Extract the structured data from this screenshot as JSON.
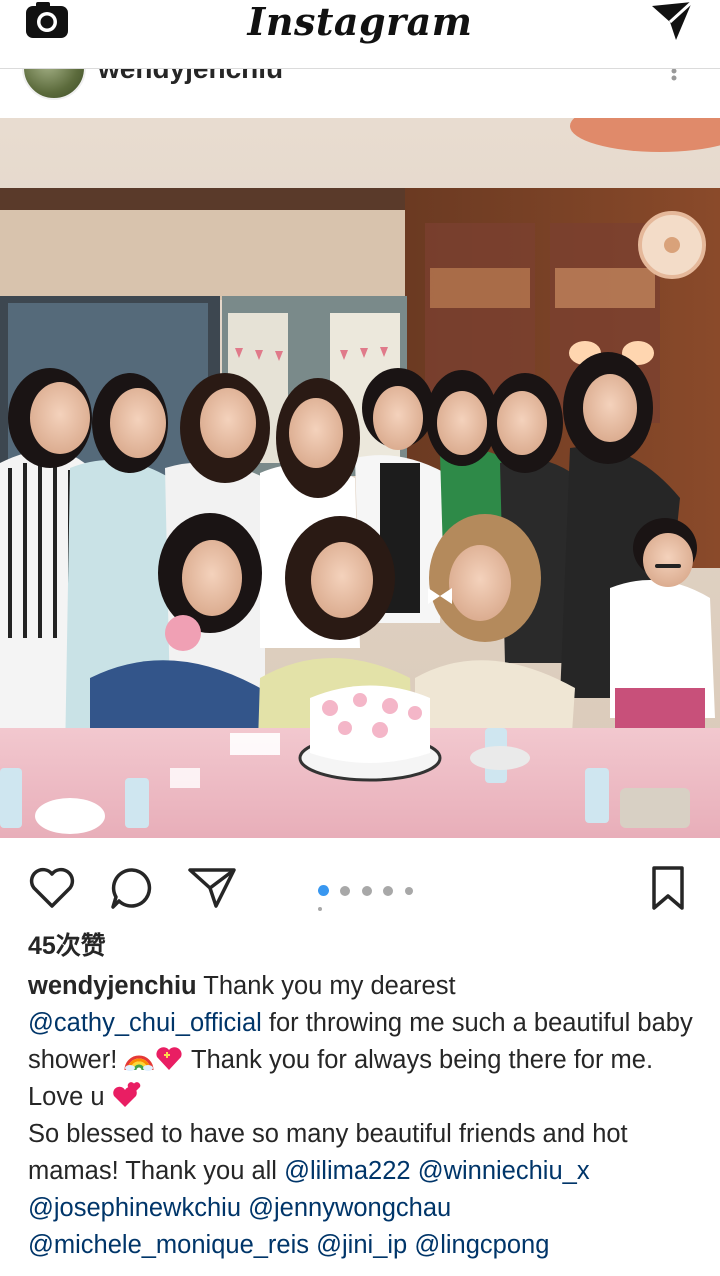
{
  "app": {
    "title": "Instagram",
    "icons": {
      "camera": "camera-icon",
      "direct": "direct-message-icon",
      "like": "heart-icon",
      "comment": "comment-icon",
      "share": "share-icon",
      "save": "bookmark-icon",
      "more": "more-options-icon"
    }
  },
  "post": {
    "author": "wendyjenchiu",
    "likes": "45次赞",
    "carousel": {
      "active_index": 1,
      "count": 6
    },
    "caption": {
      "author": "wendyjenchiu",
      "t1": " Thank you my dearest ",
      "m1": "@cathy_chui_official",
      "t2": " for throwing me such a beautiful baby shower! ",
      "t3": " Thank you for always being there for me. Love u ",
      "t4": "So blessed to have so many beautiful friends and hot mamas! Thank you all ",
      "m2": "@lilima222",
      "m3": "@winniechiu_x",
      "m4": "@josephinewkchiu",
      "m5": "@jennywongchau",
      "m6": "@michele_monique_reis",
      "m7": "@jini_ip",
      "m8": "@lingcpong",
      "emoji1": "rainbow-emoji",
      "emoji2": "sparkling-heart-emoji",
      "emoji3": "two-hearts-emoji"
    }
  },
  "colors": {
    "mention": "#003569",
    "carousel_active": "#3897f0",
    "carousel_inactive": "#a8a8a8",
    "text": "#262626"
  }
}
